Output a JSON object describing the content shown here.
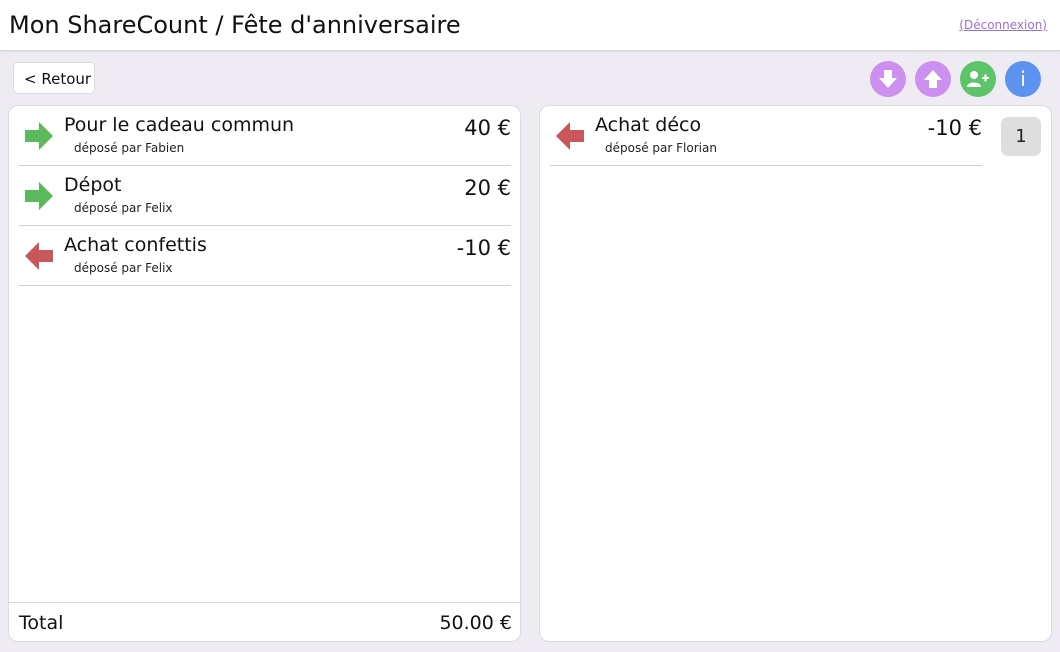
{
  "header": {
    "title": "Mon ShareCount / Fête d'anniversaire",
    "logout_label": "(Déconnexion)"
  },
  "toolbar": {
    "back_label": "< Retour",
    "buttons": [
      {
        "name": "download",
        "icon": "arrow-down-icon",
        "color": "#cd8ff0"
      },
      {
        "name": "upload",
        "icon": "arrow-up-icon",
        "color": "#cd8ff0"
      },
      {
        "name": "add-user",
        "icon": "add-user-icon",
        "color": "#5ec46a"
      },
      {
        "name": "info",
        "icon": "info-icon",
        "label": "i",
        "color": "#5b93ee"
      }
    ]
  },
  "left_panel": {
    "transactions": [
      {
        "label": "Pour le cadeau commun",
        "by": "déposé par Fabien",
        "amount": "40 €",
        "direction": "in"
      },
      {
        "label": "Dépot",
        "by": "déposé par Felix",
        "amount": "20 €",
        "direction": "in"
      },
      {
        "label": "Achat confettis",
        "by": "déposé par Felix",
        "amount": "-10 €",
        "direction": "out"
      }
    ],
    "total_label": "Total",
    "total_value": "50.00 €"
  },
  "right_panel": {
    "transactions": [
      {
        "label": "Achat déco",
        "by": "déposé par Florian",
        "amount": "-10 €",
        "direction": "out"
      }
    ],
    "badge": "1"
  },
  "colors": {
    "in_arrow": "#5cb85c",
    "out_arrow": "#c9585c",
    "background": "#eeebf2"
  }
}
